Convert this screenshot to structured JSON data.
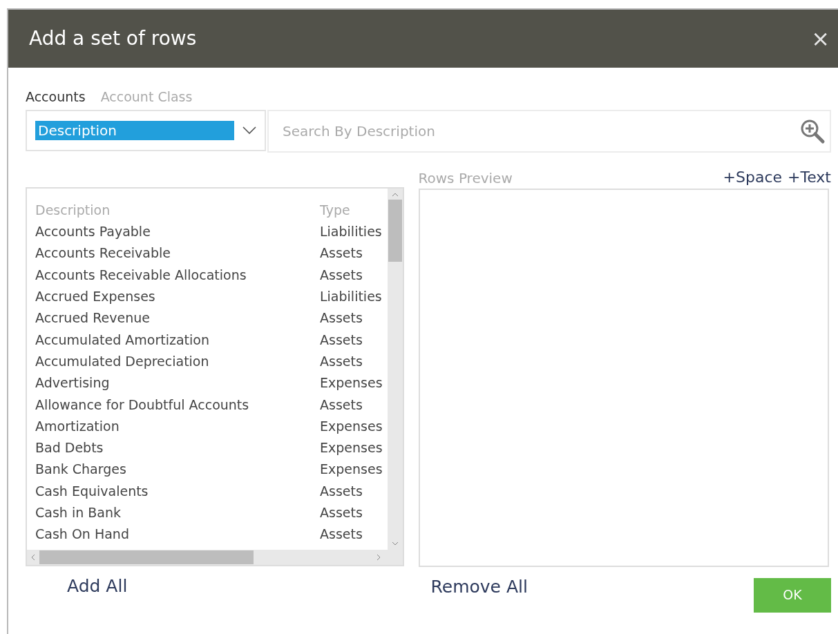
{
  "window": {
    "title": "Add a set of rows",
    "close": "×"
  },
  "tabs": [
    {
      "label": "Accounts",
      "selected": true
    },
    {
      "label": "Account Class",
      "selected": false
    }
  ],
  "filter": {
    "value": "Description"
  },
  "search": {
    "placeholder": "Search By Description"
  },
  "accounts": {
    "columns": [
      "Description",
      "Type"
    ],
    "rows": [
      {
        "description": "Accounts Payable",
        "type": "Liabilities"
      },
      {
        "description": "Accounts Receivable",
        "type": "Assets"
      },
      {
        "description": "Accounts Receivable Allocations",
        "type": "Assets"
      },
      {
        "description": "Accrued Expenses",
        "type": "Liabilities"
      },
      {
        "description": "Accrued Revenue",
        "type": "Assets"
      },
      {
        "description": "Accumulated Amortization",
        "type": "Assets"
      },
      {
        "description": "Accumulated Depreciation",
        "type": "Assets"
      },
      {
        "description": "Advertising",
        "type": "Expenses"
      },
      {
        "description": "Allowance for Doubtful Accounts",
        "type": "Assets"
      },
      {
        "description": "Amortization",
        "type": "Expenses"
      },
      {
        "description": "Bad Debts",
        "type": "Expenses"
      },
      {
        "description": "Bank Charges",
        "type": "Expenses"
      },
      {
        "description": "Cash Equivalents",
        "type": "Assets"
      },
      {
        "description": "Cash in Bank",
        "type": "Assets"
      },
      {
        "description": "Cash On Hand",
        "type": "Assets"
      }
    ]
  },
  "preview": {
    "label": "Rows Preview",
    "links": [
      "+Space",
      "+Text"
    ]
  },
  "add_all": "Add All",
  "remove_all": "Remove All",
  "ok": "OK"
}
